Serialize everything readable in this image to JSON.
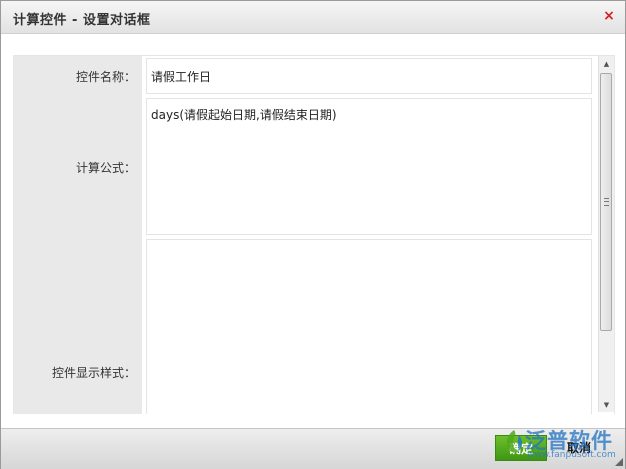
{
  "dialog": {
    "title": "计算控件 - 设置对话框",
    "close_symbol": "×"
  },
  "form": {
    "name_label": "控件名称：",
    "name_value": "请假工作日",
    "formula_label": "计算公式：",
    "formula_value": "days(请假起始日期,请假结束日期)",
    "style_label": "控件显示样式：",
    "style_value": ""
  },
  "scrollbar": {
    "up_symbol": "▲",
    "down_symbol": "▼"
  },
  "footer": {
    "confirm_label": "确定",
    "cancel_label": "取消"
  },
  "watermark": {
    "text": "泛普软件",
    "url": "www.fanpusoft.com"
  },
  "colors": {
    "accent_green": "#4fa81c",
    "close_red": "#d41f1f",
    "watermark_blue": "#2674c4"
  }
}
